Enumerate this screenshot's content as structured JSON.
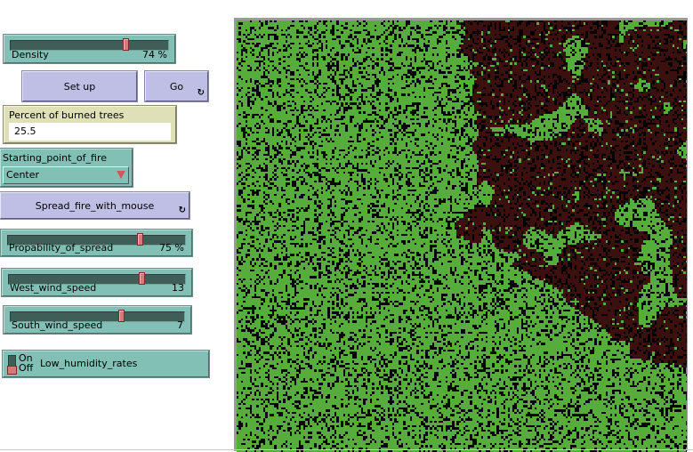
{
  "interface": {
    "density": {
      "label": "Density",
      "value": 74,
      "min": 0,
      "max": 100,
      "units": "%",
      "display": "74 %"
    },
    "setup_button": {
      "label": "Set up"
    },
    "go_button": {
      "label": "Go",
      "forever_icon": "forever-arrows-icon"
    },
    "monitor": {
      "label": "Percent of burned trees",
      "value": "25.5"
    },
    "chooser": {
      "label": "Starting_point_of_fire",
      "selected": "Center"
    },
    "spread_button": {
      "label": "Spread_fire_with_mouse",
      "forever_icon": "forever-arrows-icon"
    },
    "propability_of_spread": {
      "label": "Propability_of_spread",
      "value": 75,
      "min": 0,
      "max": 100,
      "units": "%",
      "display": "75 %"
    },
    "west_wind_speed": {
      "label": "West_wind_speed",
      "value": 13,
      "min": -25,
      "max": 25,
      "display": "13"
    },
    "south_wind_speed": {
      "label": "South_wind_speed",
      "value": 7,
      "min": -25,
      "max": 25,
      "display": "7"
    },
    "low_humidity_switch": {
      "label": "Low_humidity_rates",
      "on_label": "On",
      "off_label": "Off",
      "state": "off"
    }
  },
  "world": {
    "colors": {
      "tree": "#56ad3c",
      "empty": "#000000",
      "burned": "#3d1010"
    },
    "tree_density": 0.74,
    "burned_percent": 25.5
  }
}
